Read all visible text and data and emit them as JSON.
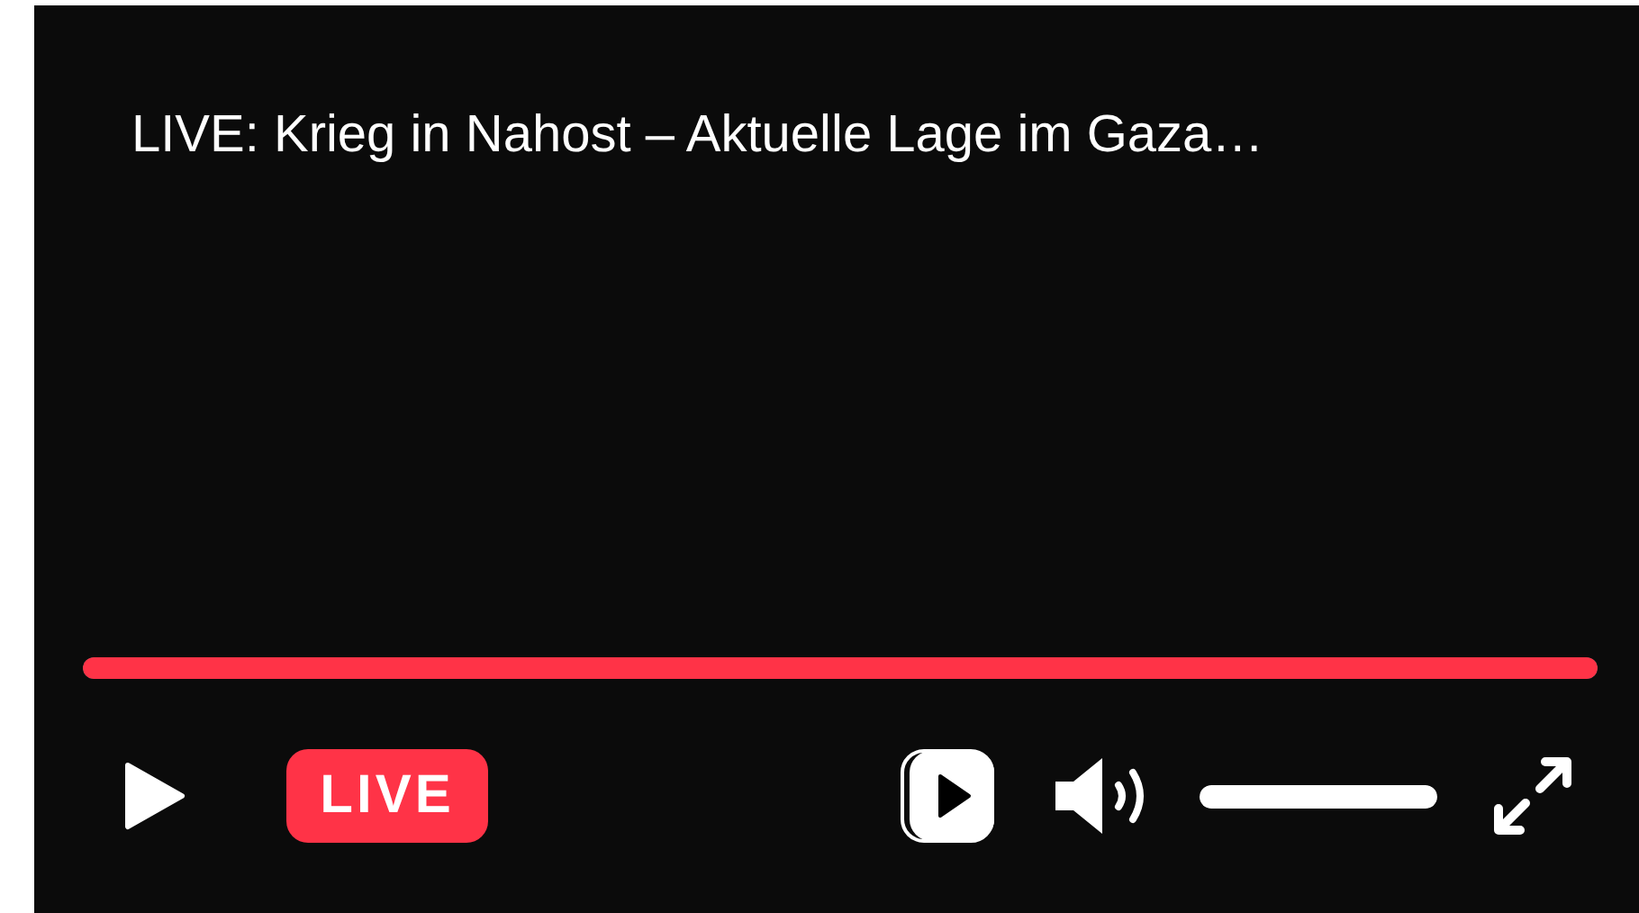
{
  "title": "LIVE: Krieg in Nahost – Aktuelle Lage im Gaza…",
  "progress": {
    "level": 1
  },
  "live_badge": "LIVE",
  "volume": {
    "level": 1
  }
}
